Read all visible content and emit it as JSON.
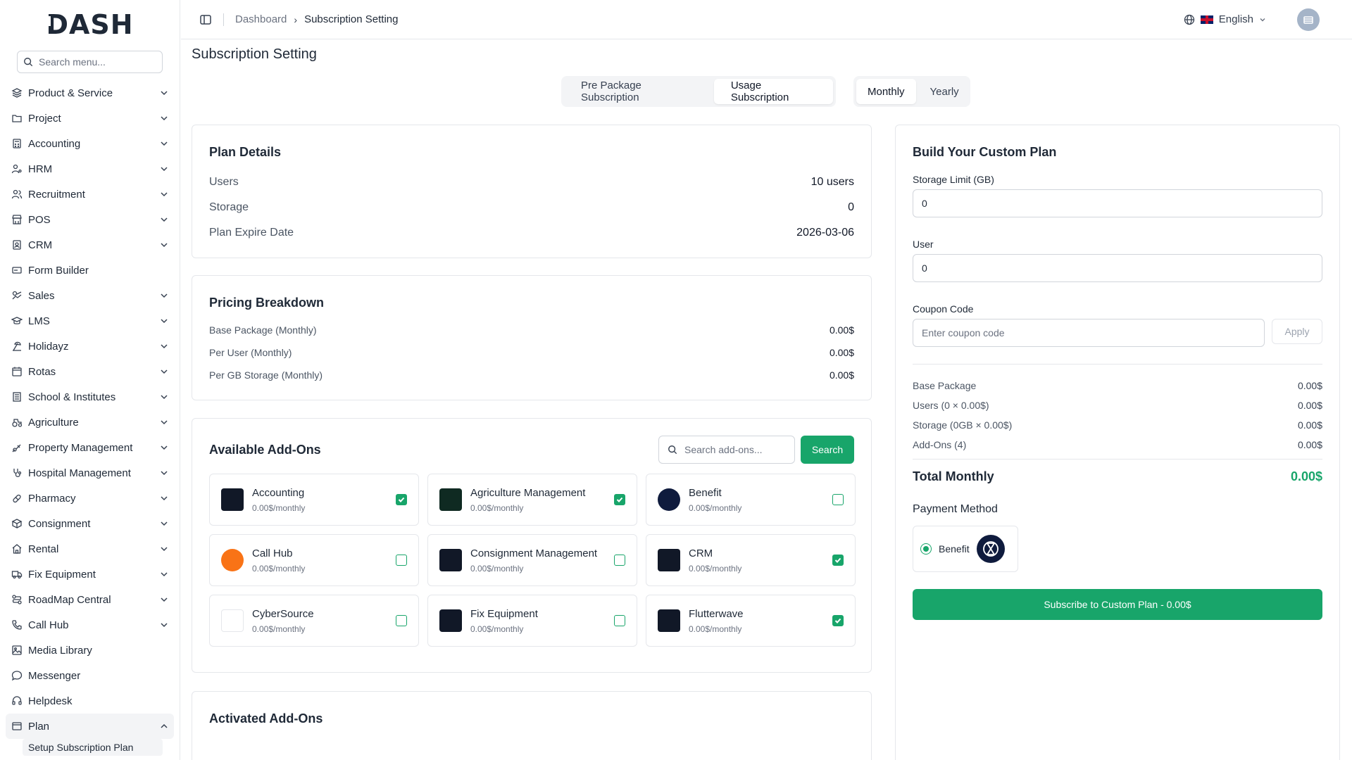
{
  "app": {
    "logo": "DASH"
  },
  "sidebar": {
    "search_placeholder": "Search menu...",
    "items": [
      {
        "label": "Product & Service",
        "icon": "layers-icon"
      },
      {
        "label": "Project",
        "icon": "folder-icon"
      },
      {
        "label": "Accounting",
        "icon": "calculator-icon"
      },
      {
        "label": "HRM",
        "icon": "user-gear-icon"
      },
      {
        "label": "Recruitment",
        "icon": "users-icon"
      },
      {
        "label": "POS",
        "icon": "store-icon"
      },
      {
        "label": "CRM",
        "icon": "contact-icon"
      },
      {
        "label": "Form Builder",
        "icon": "form-icon"
      },
      {
        "label": "Sales",
        "icon": "sales-icon"
      },
      {
        "label": "LMS",
        "icon": "graduation-cap-icon"
      },
      {
        "label": "Holidayz",
        "icon": "beach-icon"
      },
      {
        "label": "Rotas",
        "icon": "calendar-clock-icon"
      },
      {
        "label": "School & Institutes",
        "icon": "school-icon"
      },
      {
        "label": "Agriculture",
        "icon": "tractor-icon"
      },
      {
        "label": "Property Management",
        "icon": "property-icon"
      },
      {
        "label": "Hospital Management",
        "icon": "stethoscope-icon"
      },
      {
        "label": "Pharmacy",
        "icon": "pill-icon"
      },
      {
        "label": "Consignment",
        "icon": "box-icon"
      },
      {
        "label": "Rental",
        "icon": "home-icon"
      },
      {
        "label": "Fix Equipment",
        "icon": "truck-icon"
      },
      {
        "label": "RoadMap Central",
        "icon": "signpost-icon"
      },
      {
        "label": "Call Hub",
        "icon": "phone-icon"
      },
      {
        "label": "Media Library",
        "icon": "image-icon"
      },
      {
        "label": "Messenger",
        "icon": "message-icon"
      },
      {
        "label": "Helpdesk",
        "icon": "headset-icon"
      },
      {
        "label": "Plan",
        "icon": "plan-icon"
      }
    ],
    "sub_item": "Setup Subscription Plan"
  },
  "topbar": {
    "breadcrumb_root": "Dashboard",
    "breadcrumb_current": "Subscription Setting",
    "language": "English"
  },
  "page": {
    "title": "Subscription Setting",
    "tabs": [
      "Pre Package Subscription",
      "Usage Subscription"
    ],
    "periods": [
      "Monthly",
      "Yearly"
    ]
  },
  "plan_details": {
    "title": "Plan Details",
    "rows": [
      {
        "label": "Users",
        "value": "10 users"
      },
      {
        "label": "Storage",
        "value": "0"
      },
      {
        "label": "Plan Expire Date",
        "value": "2026-03-06"
      }
    ]
  },
  "pricing": {
    "title": "Pricing Breakdown",
    "rows": [
      {
        "label": "Base Package (Monthly)",
        "value": "0.00$"
      },
      {
        "label": "Per User (Monthly)",
        "value": "0.00$"
      },
      {
        "label": "Per GB Storage (Monthly)",
        "value": "0.00$"
      }
    ]
  },
  "addons": {
    "title": "Available Add-Ons",
    "search_placeholder": "Search add-ons...",
    "search_button": "Search",
    "items": [
      {
        "name": "Accounting",
        "price": "0.00$/monthly",
        "checked": true,
        "color": "#111827"
      },
      {
        "name": "Agriculture Management",
        "price": "0.00$/monthly",
        "checked": true,
        "color": "#0f2a22"
      },
      {
        "name": "Benefit",
        "price": "0.00$/monthly",
        "checked": false,
        "color": "#0f1b3d"
      },
      {
        "name": "Call Hub",
        "price": "0.00$/monthly",
        "checked": false,
        "color": "#f97316"
      },
      {
        "name": "Consignment Management",
        "price": "0.00$/monthly",
        "checked": false,
        "color": "#111827"
      },
      {
        "name": "CRM",
        "price": "0.00$/monthly",
        "checked": true,
        "color": "#111827"
      },
      {
        "name": "CyberSource",
        "price": "0.00$/monthly",
        "checked": false,
        "color": "#ffffff"
      },
      {
        "name": "Fix Equipment",
        "price": "0.00$/monthly",
        "checked": false,
        "color": "#111827"
      },
      {
        "name": "Flutterwave",
        "price": "0.00$/monthly",
        "checked": true,
        "color": "#111827"
      }
    ]
  },
  "activated": {
    "title": "Activated Add-Ons"
  },
  "custom_plan": {
    "title": "Build Your Custom Plan",
    "storage_label": "Storage Limit (GB)",
    "storage_value": "0",
    "user_label": "User",
    "user_value": "0",
    "coupon_label": "Coupon Code",
    "coupon_placeholder": "Enter coupon code",
    "apply_label": "Apply",
    "summary": [
      {
        "label": "Base Package",
        "value": "0.00$"
      },
      {
        "label": "Users (0 × 0.00$)",
        "value": "0.00$"
      },
      {
        "label": "Storage (0GB × 0.00$)",
        "value": "0.00$"
      },
      {
        "label": "Add-Ons (4)",
        "value": "0.00$"
      }
    ],
    "total_label": "Total Monthly",
    "total_value": "0.00$",
    "payment_title": "Payment Method",
    "payment_option": "Benefit",
    "subscribe_label": "Subscribe to Custom Plan - 0.00$"
  },
  "colors": {
    "accent": "#18a56a"
  }
}
